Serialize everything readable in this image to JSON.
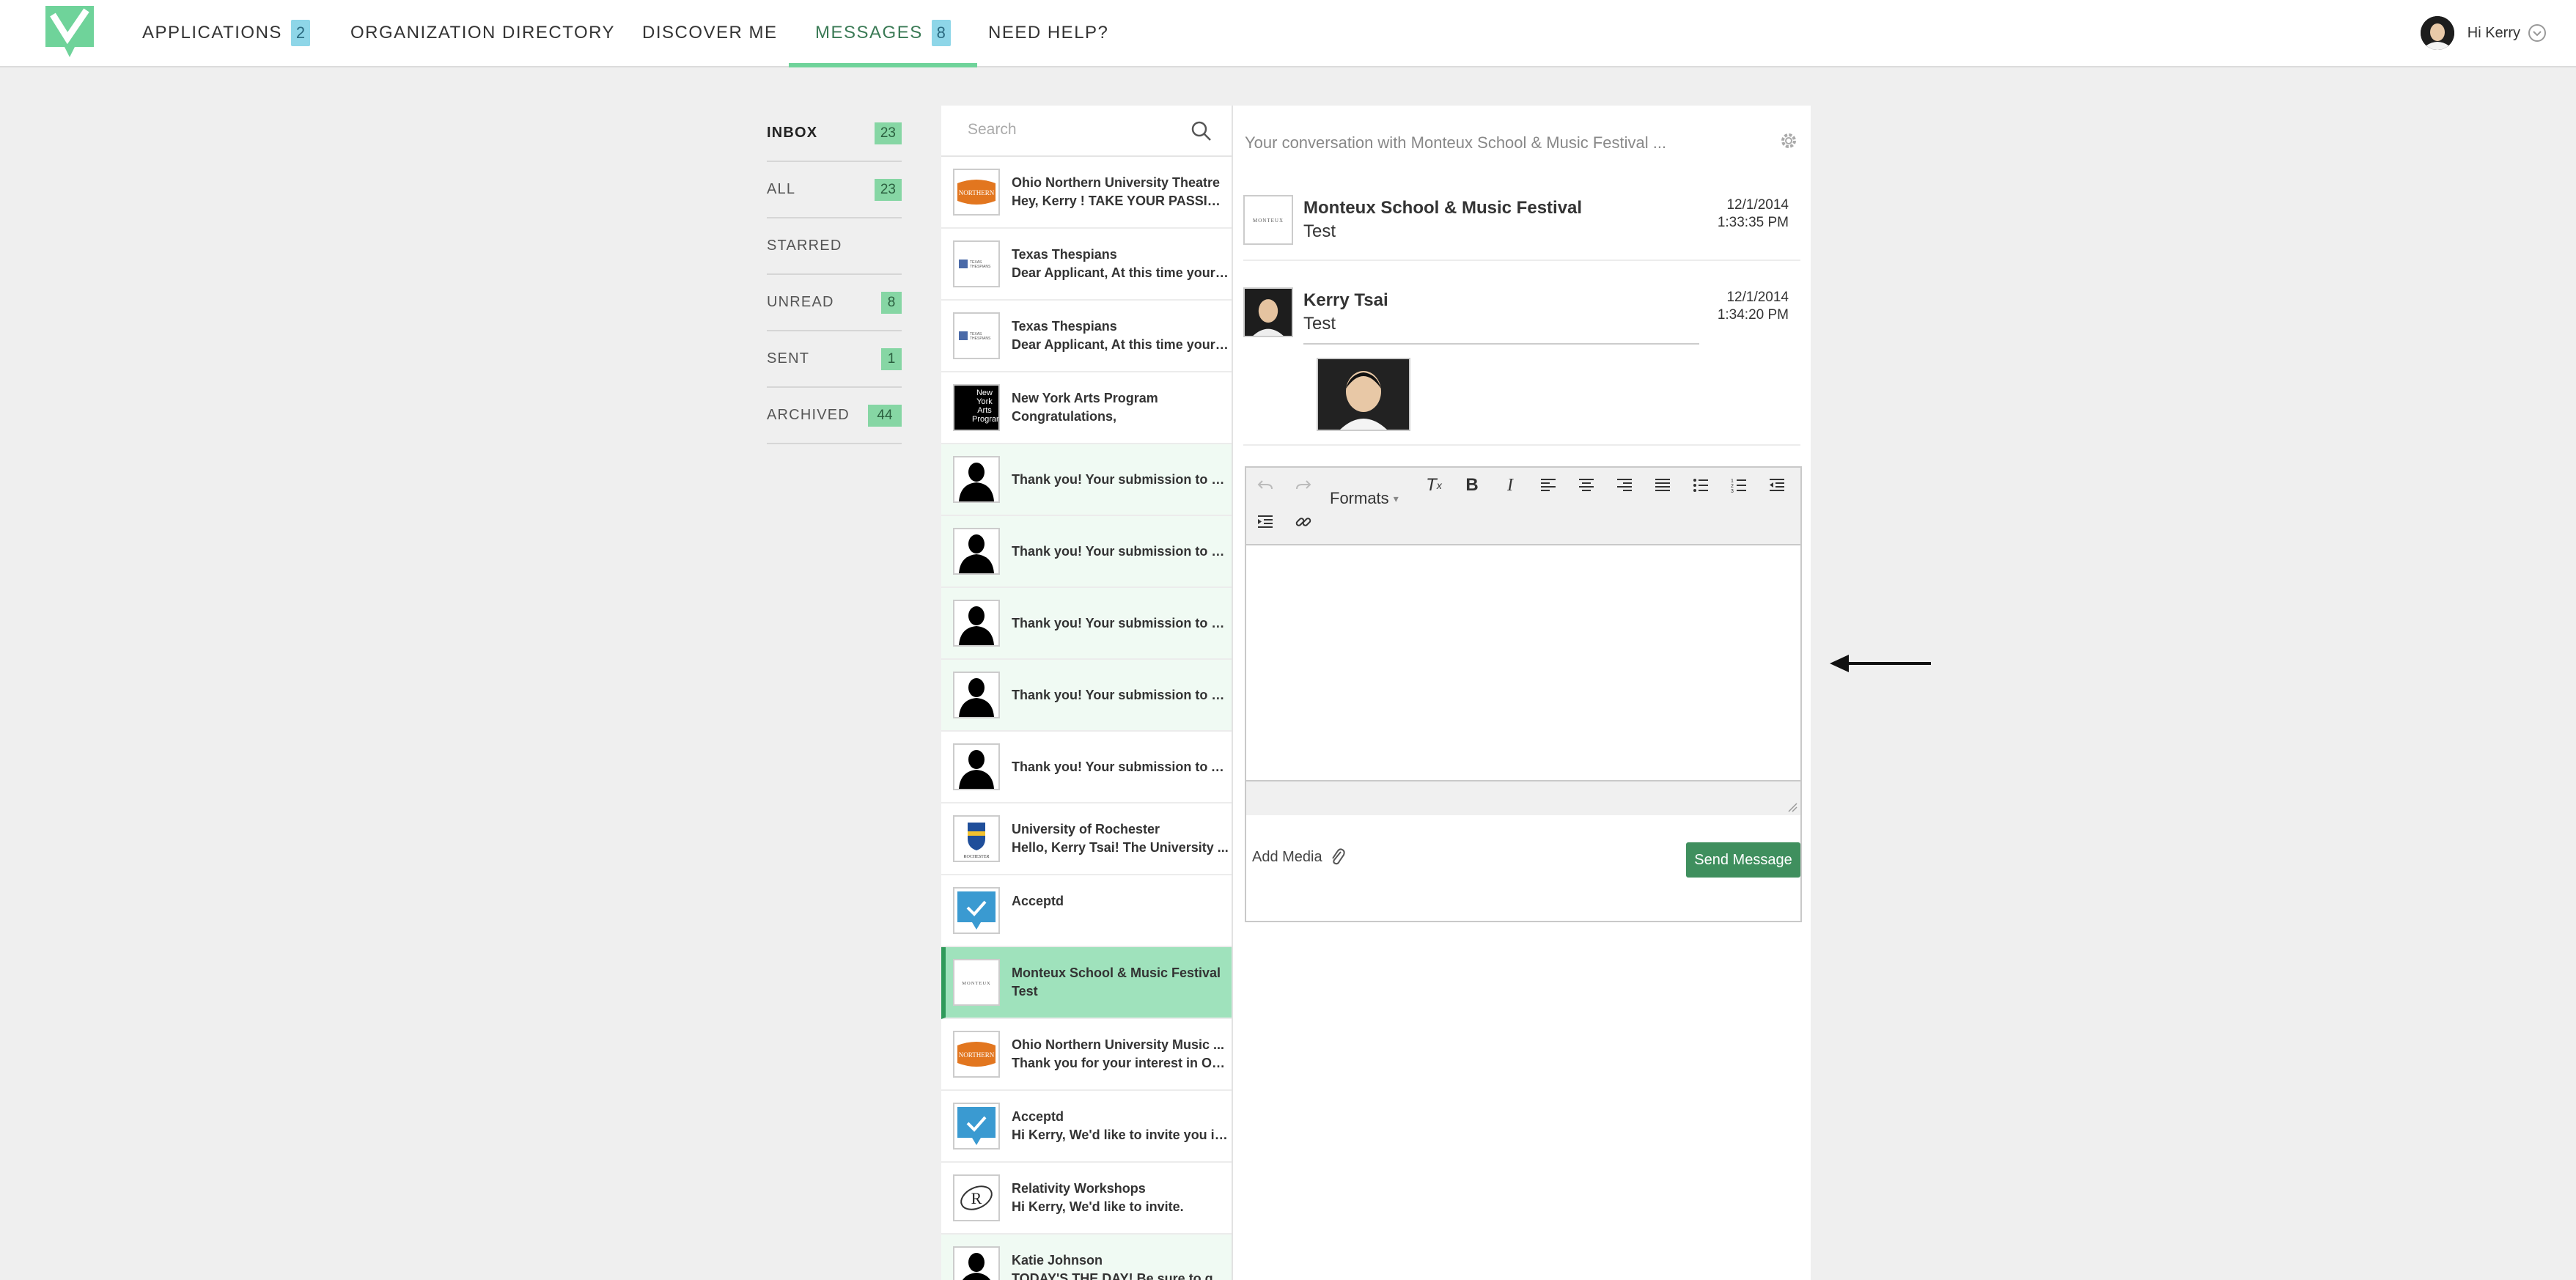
{
  "nav": {
    "items": [
      {
        "label": "APPLICATIONS",
        "badge": "2"
      },
      {
        "label": "ORGANIZATION DIRECTORY"
      },
      {
        "label": "DISCOVER ME"
      },
      {
        "label": "MESSAGES",
        "badge": "8"
      },
      {
        "label": "NEED HELP?"
      }
    ],
    "active": "MESSAGES",
    "greeting": "Hi Kerry"
  },
  "folders": [
    {
      "label": "INBOX",
      "count": "23"
    },
    {
      "label": "ALL",
      "count": "23"
    },
    {
      "label": "STARRED",
      "count": ""
    },
    {
      "label": "UNREAD",
      "count": "8"
    },
    {
      "label": "SENT",
      "count": "1"
    },
    {
      "label": "ARCHIVED",
      "count": "44"
    }
  ],
  "search": {
    "placeholder": "Search"
  },
  "messages": [
    {
      "from": "Ohio Northern University Theatre",
      "preview": "Hey, Kerry ! TAKE YOUR PASSION...",
      "thumb": "onu-logo",
      "state": "read"
    },
    {
      "from": "Texas Thespians",
      "preview": "Dear Applicant, At this time your ...",
      "thumb": "texas-thespians-logo",
      "state": "read"
    },
    {
      "from": "Texas Thespians",
      "preview": "Dear Applicant, At this time your ...",
      "thumb": "texas-thespians-logo",
      "state": "read"
    },
    {
      "from": "New York Arts Program",
      "preview": "Congratulations,",
      "thumb": "nyap-logo",
      "thumb_text": "New York Arts Program",
      "state": "read"
    },
    {
      "from": "",
      "preview": "Thank you! Your submission to B...",
      "thumb": "silhouette",
      "state": "unread"
    },
    {
      "from": "",
      "preview": "Thank you! Your submission to BF...",
      "thumb": "silhouette",
      "state": "unread"
    },
    {
      "from": "",
      "preview": "Thank you! Your submission to BF...",
      "thumb": "silhouette",
      "state": "unread"
    },
    {
      "from": "",
      "preview": "Thank you! Your submission to BF...",
      "thumb": "silhouette",
      "state": "unread"
    },
    {
      "from": "",
      "preview": "Thank you! Your submission to A...",
      "thumb": "silhouette",
      "state": "read"
    },
    {
      "from": "University of Rochester",
      "preview": "Hello, Kerry Tsai! The University ...",
      "thumb": "rochester-logo",
      "state": "read"
    },
    {
      "from": "Acceptd",
      "preview": "",
      "thumb": "acceptd-logo",
      "state": "read"
    },
    {
      "from": "Monteux School & Music Festival",
      "preview": "Test",
      "thumb": "monteux-logo",
      "state": "selected"
    },
    {
      "from": "Ohio Northern University Music ...",
      "preview": "Thank you for your interest in Ohi...",
      "thumb": "onu-logo",
      "state": "read"
    },
    {
      "from": "Acceptd",
      "preview": "Hi Kerry, We'd like to invite you in...",
      "thumb": "acceptd-logo",
      "state": "read"
    },
    {
      "from": "Relativity Workshops",
      "preview": "Hi Kerry, We'd like to invite.",
      "thumb": "relativity-logo",
      "state": "read"
    },
    {
      "from": "Katie Johnson",
      "preview": "TODAY'S THE DAY! Be sure to ge...",
      "thumb": "silhouette",
      "state": "unread"
    }
  ],
  "conversation": {
    "header": "Your conversation with Monteux School & Music Festival ...",
    "entries": [
      {
        "name": "Monteux School & Music Festival",
        "body": "Test",
        "date": "12/1/2014",
        "time": "1:33:35 PM"
      },
      {
        "name": "Kerry Tsai",
        "body": "Test",
        "date": "12/1/2014",
        "time": "1:34:20 PM"
      }
    ]
  },
  "editor": {
    "formats_label": "Formats",
    "toolbar_icons": [
      "undo-icon",
      "redo-icon",
      "clear-format-icon",
      "bold-icon",
      "italic-icon",
      "align-left-icon",
      "align-center-icon",
      "align-right-icon",
      "justify-icon",
      "bullet-list-icon",
      "numbered-list-icon",
      "outdent-icon",
      "indent-icon",
      "link-icon"
    ]
  },
  "compose": {
    "add_media_label": "Add Media",
    "send_label": "Send Message"
  },
  "colors": {
    "accent_green": "#6fd39a",
    "badge_green": "#86d6a4",
    "selected_row": "#9fe2bc",
    "send_button": "#3f8f5e",
    "badge_blue": "#8ed6e8"
  }
}
